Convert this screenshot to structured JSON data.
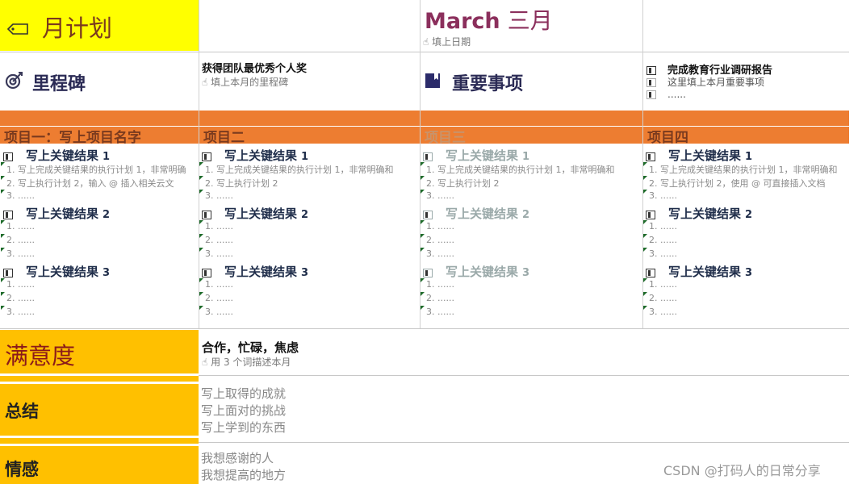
{
  "header": {
    "month_plan_title": "月计划",
    "month_en": "March",
    "month_cn": "三月",
    "date_hint": "填上日期"
  },
  "milestone": {
    "label": "里程碑",
    "value": "获得团队最优秀个人奖",
    "hint": "填上本月的里程碑"
  },
  "important": {
    "label": "重要事项",
    "items": [
      "完成教育行业调研报告",
      "这里填上本月重要事项",
      "......"
    ]
  },
  "projects": [
    {
      "title": "项目一：写上项目名字",
      "key_results": [
        {
          "label": "写上关键结果",
          "num": "1",
          "plans": [
            "1. 写上完成关键结果的执行计划 1，非常明确",
            "2. 写上执行计划 2，输入 @ 插入相关云文",
            "3. ......"
          ]
        },
        {
          "label": "写上关键结果",
          "num": "2",
          "plans": [
            "1. ......",
            "2. ......",
            "3. ......"
          ]
        },
        {
          "label": "写上关键结果",
          "num": "3",
          "plans": [
            "1. ......",
            "2. ......",
            "3. ......"
          ]
        }
      ]
    },
    {
      "title": "项目二",
      "key_results": [
        {
          "label": "写上关键结果",
          "num": "1",
          "plans": [
            "1. 写上完成关键结果的执行计划 1，非常明确和",
            "2. 写上执行计划 2",
            "3. ......"
          ]
        },
        {
          "label": "写上关键结果",
          "num": "2",
          "plans": [
            "1. ......",
            "2. ......",
            "3. ......"
          ]
        },
        {
          "label": "写上关键结果",
          "num": "3",
          "plans": [
            "1. ......",
            "2. ......",
            "3. ......"
          ]
        }
      ]
    },
    {
      "title": "项目三",
      "key_results": [
        {
          "label": "写上关键结果",
          "num": "1",
          "plans": [
            "1. 写上完成关键结果的执行计划 1，非常明确和",
            "2. 写上执行计划 2",
            "3. ......"
          ]
        },
        {
          "label": "写上关键结果",
          "num": "2",
          "plans": [
            "1. ......",
            "2. ......",
            "3. ......"
          ]
        },
        {
          "label": "写上关键结果",
          "num": "3",
          "plans": [
            "1. ......",
            "2. ......",
            "3. ......"
          ]
        }
      ]
    },
    {
      "title": "项目四",
      "key_results": [
        {
          "label": "写上关键结果",
          "num": "1",
          "plans": [
            "1. 写上完成关键结果的执行计划 1，非常明确和",
            "2. 写上执行计划 2，使用 @ 可直接插入文档",
            "3. ......"
          ]
        },
        {
          "label": "写上关键结果",
          "num": "2",
          "plans": [
            "1. ......",
            "2. ......",
            "3. ......"
          ]
        },
        {
          "label": "写上关键结果",
          "num": "3",
          "plans": [
            "1. ......",
            "2. ......",
            "3. ......"
          ]
        }
      ]
    }
  ],
  "satisfaction": {
    "label": "满意度",
    "value": "合作，忙碌，焦虑",
    "hint": "用 3 个词描述本月"
  },
  "summary": {
    "label": "总结",
    "lines": [
      "写上取得的成就",
      "写上面对的挑战",
      "写上学到的东西"
    ]
  },
  "emotion": {
    "label": "情感",
    "lines": [
      "我想感谢的人",
      "我想提高的地方"
    ]
  },
  "watermark": "CSDN @打码人的日常分享",
  "colors": {
    "yellow": "#ffff00",
    "gold": "#ffc000",
    "orange": "#ed7d31",
    "month_purple": "#8b2f5c",
    "heading_navy": "#1f2d4a"
  }
}
